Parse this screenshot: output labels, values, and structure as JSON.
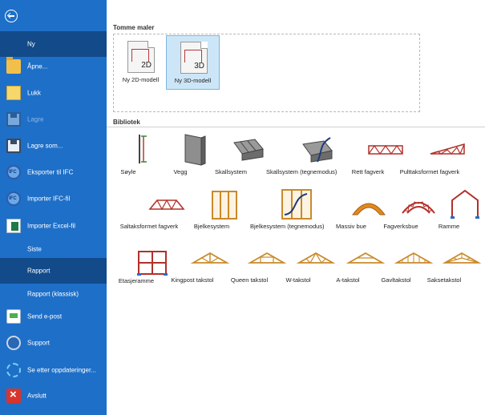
{
  "sidebar": {
    "back_icon": "back-arrow-icon",
    "items": [
      {
        "label": "Ny",
        "icon": "",
        "state": "selected"
      },
      {
        "label": "Åpne...",
        "icon": "folder-icon"
      },
      {
        "label": "Lukk",
        "icon": "file-icon"
      },
      {
        "label": "Lagre",
        "icon": "save-icon",
        "state": "disabled"
      },
      {
        "label": "Lagre som...",
        "icon": "save-as-icon"
      },
      {
        "label": "Eksporter til IFC",
        "icon": "ifc-export-icon"
      },
      {
        "label": "Importer IFC-fil",
        "icon": "ifc-import-icon"
      },
      {
        "label": "Importer Excel-fil",
        "icon": "excel-import-icon"
      },
      {
        "label": "Siste",
        "icon": ""
      },
      {
        "label": "Rapport",
        "icon": "",
        "state": "selected"
      },
      {
        "label": "Rapport (klassisk)",
        "icon": ""
      },
      {
        "label": "Send e-post",
        "icon": "mail-icon"
      },
      {
        "label": "Support",
        "icon": "support-icon"
      },
      {
        "label": "Se etter oppdateringer...",
        "icon": "update-icon"
      },
      {
        "label": "Avslutt",
        "icon": "exit-icon"
      }
    ]
  },
  "tomme_maler": {
    "title": "Tomme maler",
    "templates": [
      {
        "label": "Ny 2D-modell",
        "dim": "2D"
      },
      {
        "label": "Ny 3D-modell",
        "dim": "3D",
        "selected": true
      }
    ]
  },
  "bibliotek": {
    "title": "Bibliotek",
    "items": [
      {
        "label": "Søyle"
      },
      {
        "label": "Vegg"
      },
      {
        "label": "Skallsystem"
      },
      {
        "label": "Skallsystem (tegnemodus)"
      },
      {
        "label": "Rett fagverk"
      },
      {
        "label": "Pulttaksformet fagverk"
      },
      {
        "label": "Saltaksformet fagverk"
      },
      {
        "label": "Bjelkesystem"
      },
      {
        "label": "Bjelkesystem (tegnemodus)"
      },
      {
        "label": "Massiv bue"
      },
      {
        "label": "Fagverksbue"
      },
      {
        "label": "Ramme"
      },
      {
        "label": "Etasjeramme"
      },
      {
        "label": "Kingpost takstol"
      },
      {
        "label": "Queen takstol"
      },
      {
        "label": "W-takstol"
      },
      {
        "label": "A-takstol"
      },
      {
        "label": "Gavltakstol"
      },
      {
        "label": "Saksetakstol"
      }
    ]
  }
}
